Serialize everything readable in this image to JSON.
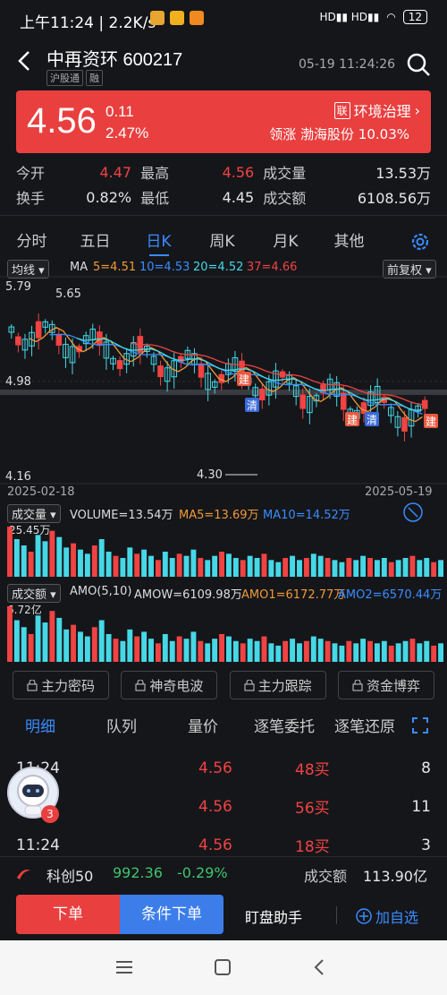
{
  "status": {
    "time": "上午11:24 | 2.2K/s",
    "battery": "12"
  },
  "header": {
    "name": "中再资环 600217",
    "tags": [
      "沪股通",
      "融"
    ],
    "datetime": "05-19 11:24:26"
  },
  "quote": {
    "price": "4.56",
    "change": "0.11",
    "change_pct": "2.47%",
    "sector_tag": "联",
    "sector": "环境治理",
    "leader_label": "领涨",
    "leader": "渤海股份 10.03%"
  },
  "stats": {
    "open_label": "今开",
    "open": "4.47",
    "high_label": "最高",
    "high": "4.56",
    "vol_label": "成交量",
    "vol": "13.53万",
    "turnover_label": "换手",
    "turnover": "0.82%",
    "low_label": "最低",
    "low": "4.45",
    "amt_label": "成交额",
    "amt": "6108.56万"
  },
  "tabs": [
    "分时",
    "五日",
    "日K",
    "周K",
    "月K",
    "其他"
  ],
  "chart_top": {
    "line_sel": "均线",
    "ma": "MA",
    "ma5": "5=4.51",
    "ma10": "10=4.53",
    "ma20": "20=4.52",
    "ma37": "37=4.66",
    "adjust": "前复权"
  },
  "kchart_labels": {
    "high": "5.79",
    "high_mark": "5.65",
    "mid": "4.98",
    "low": "4.16",
    "low_mark": "4.30",
    "start": "2025-02-18",
    "end": "2025-05-19",
    "jian": "建",
    "qing": "清"
  },
  "volume": {
    "sel": "成交量",
    "vol": "VOLUME=13.54万",
    "ma5": "MA5=13.69万",
    "ma10": "MA10=14.52万",
    "max": "25.45万"
  },
  "amount": {
    "sel": "成交额",
    "amo": "AMO(5,10)",
    "amow": "AMOW=6109.98万",
    "amo1": "AMO1=6172.77万",
    "amo2": "AMO2=6570.44万",
    "max": "6.72亿"
  },
  "features": [
    "主力密码",
    "神奇电波",
    "主力跟踪",
    "资金博弈"
  ],
  "detail_tabs": [
    "明细",
    "队列",
    "量价",
    "逐笔委托",
    "逐笔还原"
  ],
  "trades": [
    {
      "time": "11:24",
      "price": "4.56",
      "vol": "48买",
      "n": "8"
    },
    {
      "time": "",
      "price": "4.56",
      "vol": "56买",
      "n": "11"
    },
    {
      "time": "11:24",
      "price": "4.56",
      "vol": "18买",
      "n": "3"
    }
  ],
  "avatar_badge": "3",
  "index_bar": {
    "name": "科创50",
    "value": "992.36",
    "chg": "-0.29%",
    "amt_label": "成交额",
    "amt": "113.90亿"
  },
  "bottom": {
    "order": "下单",
    "cond": "条件下单",
    "watch": "盯盘助手",
    "add": "加自选"
  },
  "colors": {
    "up": "#f04343",
    "down": "#46d8e6",
    "accent": "#3a8cff",
    "ma5": "#f09a38",
    "ma10": "#3a8cff",
    "ma20": "#46d8e6",
    "ma37": "#f04343"
  },
  "chart_data": {
    "type": "bar",
    "title": "",
    "series": [
      {
        "name": "VOLUME",
        "values": [
          24,
          18,
          15,
          12,
          20,
          17,
          22,
          19,
          14,
          16,
          13,
          11,
          15,
          18,
          12,
          10,
          9,
          14,
          11,
          13,
          10,
          8,
          12,
          9,
          11,
          10,
          13,
          9,
          8,
          10,
          12,
          11,
          9,
          8,
          10,
          9,
          11,
          8,
          7,
          9,
          10,
          8,
          9,
          11,
          10,
          9,
          8,
          7,
          9,
          8,
          10,
          9,
          8,
          9,
          7,
          8,
          9,
          10,
          8,
          9,
          7,
          8
        ]
      }
    ]
  }
}
